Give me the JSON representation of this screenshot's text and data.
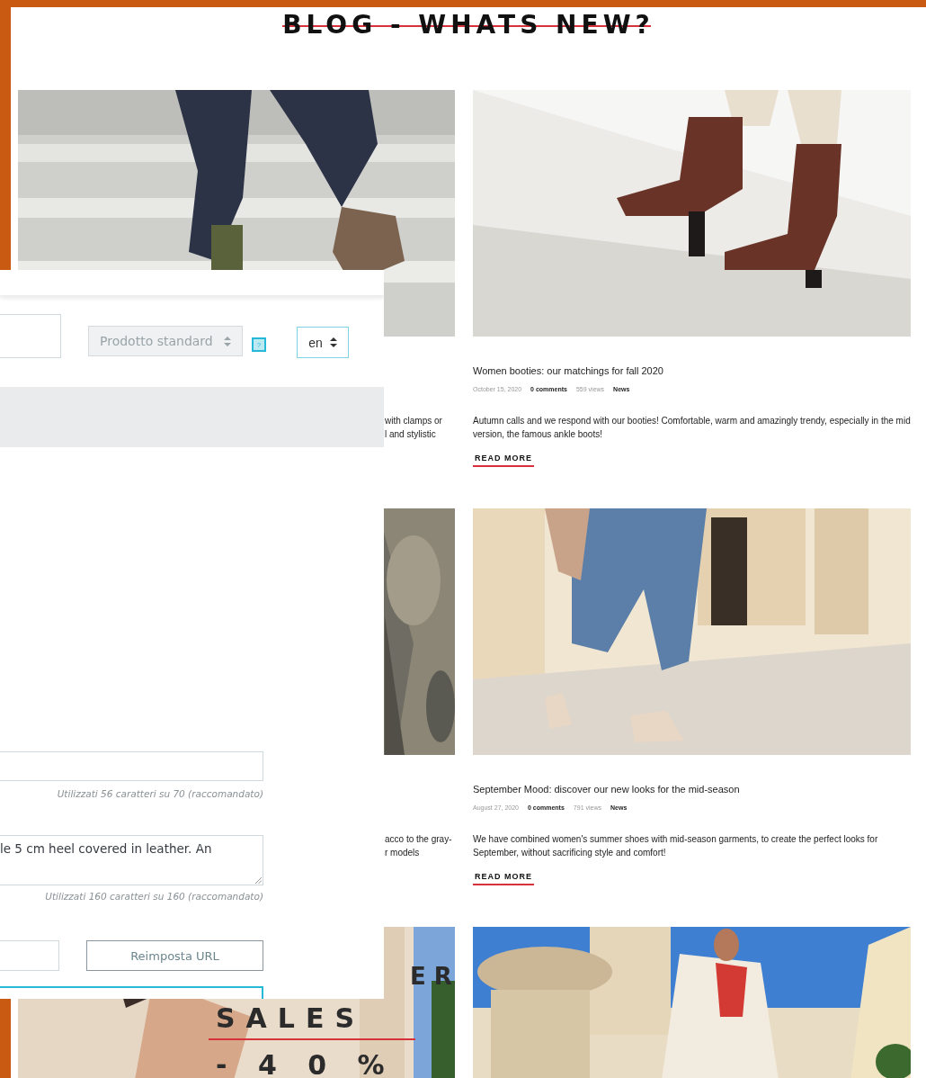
{
  "header": {
    "title": "BLOG - WHATS NEW?"
  },
  "posts": [
    {
      "image": {
        "kind": "picture"
      },
      "excerpt_lines": [
        "with clamps or",
        "l and stylistic"
      ]
    },
    {
      "image": {
        "kind": "picture"
      },
      "title": "Women booties: our matchings for fall 2020",
      "date": "October 15, 2020",
      "comments": "0 comments",
      "views": "559 views",
      "category": "News",
      "excerpt": "Autumn calls and we respond with our booties! Comfortable, warm and amazingly trendy, especially in the mid version, the famous ankle boots!",
      "read_more": "READ MORE"
    },
    {
      "image": {
        "kind": "picture"
      },
      "excerpt_lines": [
        "acco to the gray-",
        "r models"
      ]
    },
    {
      "image": {
        "kind": "picture"
      },
      "title": "September Mood: discover our new looks for the mid-season",
      "date": "August 27, 2020",
      "comments": "0 comments",
      "views": "791 views",
      "category": "News",
      "excerpt": "We have combined women's summer shoes with mid-season garments, to create the perfect looks for September, without sacrificing style and comfort!",
      "read_more": "READ MORE"
    },
    {
      "image": {
        "kind": "picture"
      },
      "banner": {
        "line_1": "E R",
        "line_2": "SALES",
        "line_3": "- 4 0 %"
      }
    },
    {
      "image": {
        "kind": "picture"
      }
    }
  ],
  "editor_panel": {
    "product_type_select": "Prodotto standard",
    "help_button": "?",
    "language_select": "en",
    "meta_title_hint": "Utilizzati 56 caratteri su 70 (raccomandato)",
    "meta_description": {
      "value": "le  5 cm heel covered in leather. An",
      "hint": "Utilizzati 160 caratteri su 160 (raccomandato)"
    },
    "reset_url_button": "Reimposta URL"
  }
}
